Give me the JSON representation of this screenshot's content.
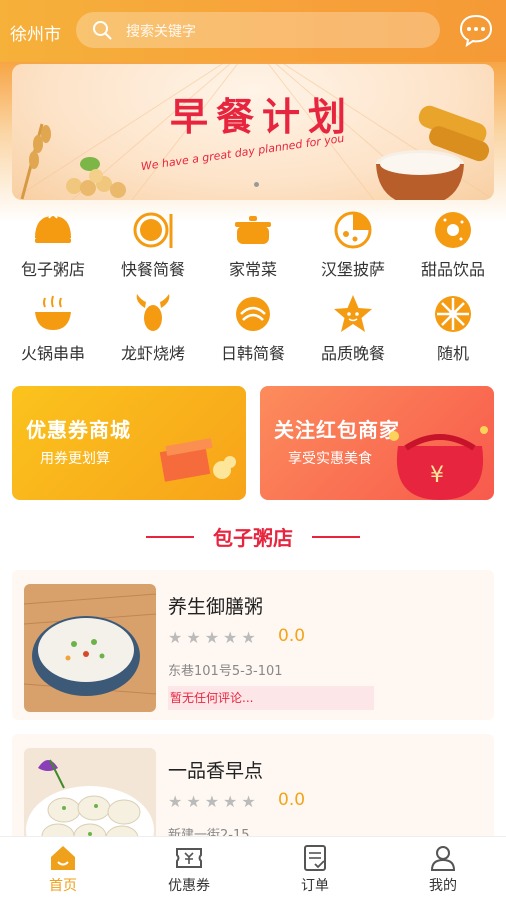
{
  "header": {
    "city": "徐州市",
    "search_placeholder": "搜索关键字"
  },
  "banner": {
    "title": "早餐计划",
    "subtitle": "We have a great day planned for you"
  },
  "categories": [
    {
      "label": "包子粥店",
      "icon": "bun-icon"
    },
    {
      "label": "快餐简餐",
      "icon": "plate-icon"
    },
    {
      "label": "家常菜",
      "icon": "pot-icon"
    },
    {
      "label": "汉堡披萨",
      "icon": "pizza-icon"
    },
    {
      "label": "甜品饮品",
      "icon": "donut-icon"
    },
    {
      "label": "火锅串串",
      "icon": "hotpot-icon"
    },
    {
      "label": "龙虾烧烤",
      "icon": "lobster-icon"
    },
    {
      "label": "日韩简餐",
      "icon": "sushi-icon"
    },
    {
      "label": "品质晚餐",
      "icon": "star-icon"
    },
    {
      "label": "随机",
      "icon": "random-icon"
    }
  ],
  "promos": {
    "left": {
      "title": "优惠券商城",
      "sub": "用券更划算"
    },
    "right": {
      "title": "关注红包商家",
      "sub": "享受实惠美食"
    }
  },
  "section": {
    "title": "包子粥店"
  },
  "shops": [
    {
      "name": "养生御膳粥",
      "score": "0.0",
      "address": "东巷101号5-3-101",
      "review": "暂无任何评论..."
    },
    {
      "name": "一品香早点",
      "score": "0.0",
      "address": "新建一街2-15",
      "review": ""
    }
  ],
  "nav": [
    {
      "label": "首页",
      "icon": "home-icon",
      "active": true
    },
    {
      "label": "优惠券",
      "icon": "coupon-icon"
    },
    {
      "label": "订单",
      "icon": "order-icon"
    },
    {
      "label": "我的",
      "icon": "user-icon"
    }
  ],
  "colors": {
    "accent": "#f6a833",
    "red": "#e8253e"
  }
}
